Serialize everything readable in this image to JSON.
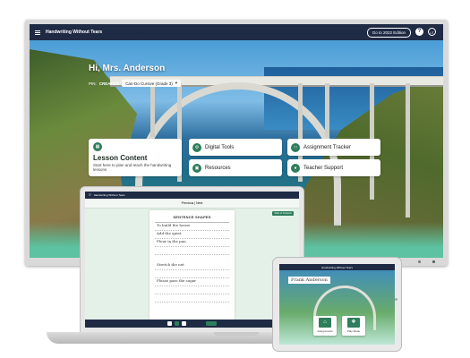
{
  "app": {
    "title": "Handwriting Without Tears",
    "edition_button": "Go to 2022 Edition",
    "help_icon": "?",
    "avatar_initials": "LT"
  },
  "greeting": {
    "text": "Hi, Mrs. Anderson",
    "pin_label": "PIN:",
    "pin_value": "CREATIVE",
    "class_select": "Can-Do Cursive (Grade 3)"
  },
  "cards": {
    "lesson": {
      "title": "Lesson Content",
      "description": "Start here to plan and teach the handwriting lessons",
      "icon": "book-icon"
    },
    "digital_tools": {
      "label": "Digital Tools",
      "icon": "wrench-icon"
    },
    "assignment_tracker": {
      "label": "Assignment Tracker",
      "icon": "chart-icon"
    },
    "resources": {
      "label": "Resources",
      "icon": "folder-icon"
    },
    "teacher_support": {
      "label": "Teacher Support",
      "icon": "person-icon"
    }
  },
  "laptop": {
    "app_title": "Handwriting Without Tears",
    "nav": "Previous | Next",
    "side_button": "Table of Contents",
    "worksheet_title": "SENTENCE SHAPES",
    "handwriting_lines": [
      "To build the house",
      "Add the quiet",
      "Flour in the pan",
      "Stretch the net",
      "Please pass the sugar"
    ]
  },
  "tablet": {
    "app_title": "Handwriting Without Tears",
    "student_name": "Frank Anderson",
    "cards": [
      {
        "label": "Assignments",
        "icon": "building-icon"
      },
      {
        "label": "Play Mode",
        "icon": "controller-icon"
      }
    ]
  },
  "colors": {
    "nav": "#1f2a44",
    "accent": "#2e7d5b",
    "mint": "#e4f1e9"
  }
}
